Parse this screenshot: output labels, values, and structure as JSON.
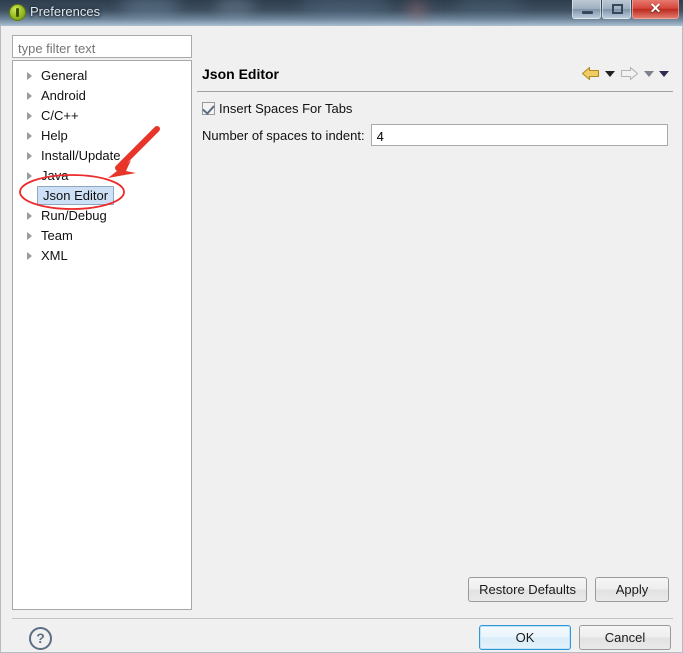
{
  "window": {
    "title": "Preferences",
    "app_icon": "eclipse-icon",
    "controls": {
      "minimize": "minimize-icon",
      "maximize": "maximize-icon",
      "close": "✕"
    }
  },
  "filter": {
    "placeholder": "type filter text",
    "value": ""
  },
  "tree": {
    "items": [
      {
        "label": "General",
        "expandable": true,
        "selected": false
      },
      {
        "label": "Android",
        "expandable": true,
        "selected": false
      },
      {
        "label": "C/C++",
        "expandable": true,
        "selected": false
      },
      {
        "label": "Help",
        "expandable": true,
        "selected": false
      },
      {
        "label": "Install/Update",
        "expandable": true,
        "selected": false
      },
      {
        "label": "Java",
        "expandable": true,
        "selected": false
      },
      {
        "label": "Json Editor",
        "expandable": false,
        "selected": true
      },
      {
        "label": "Run/Debug",
        "expandable": true,
        "selected": false
      },
      {
        "label": "Team",
        "expandable": true,
        "selected": false
      },
      {
        "label": "XML",
        "expandable": true,
        "selected": false
      }
    ]
  },
  "content": {
    "title": "Json Editor",
    "nav": {
      "back_icon": "back-arrow-icon",
      "back_menu_icon": "chevron-down-icon",
      "forward_icon": "forward-arrow-icon",
      "forward_menu_icon": "chevron-down-icon",
      "view_menu_icon": "chevron-down-icon"
    },
    "insert_spaces": {
      "label": "Insert Spaces For Tabs",
      "checked": true
    },
    "indent": {
      "label": "Number of spaces to indent:",
      "value": "4"
    },
    "restore_defaults_label": "Restore Defaults",
    "apply_label": "Apply"
  },
  "footer": {
    "help_icon": "?",
    "ok_label": "OK",
    "cancel_label": "Cancel"
  },
  "annotation": {
    "ellipse_color": "#ee2b2b",
    "arrow_color": "#e8352a",
    "target": "Json Editor"
  },
  "colors": {
    "titlebar": "#34465a",
    "close_button": "#c8392b",
    "selection": "#cde0f5",
    "default_button_focus": "#2f96d8",
    "back_arrow": "#e8c14a"
  }
}
